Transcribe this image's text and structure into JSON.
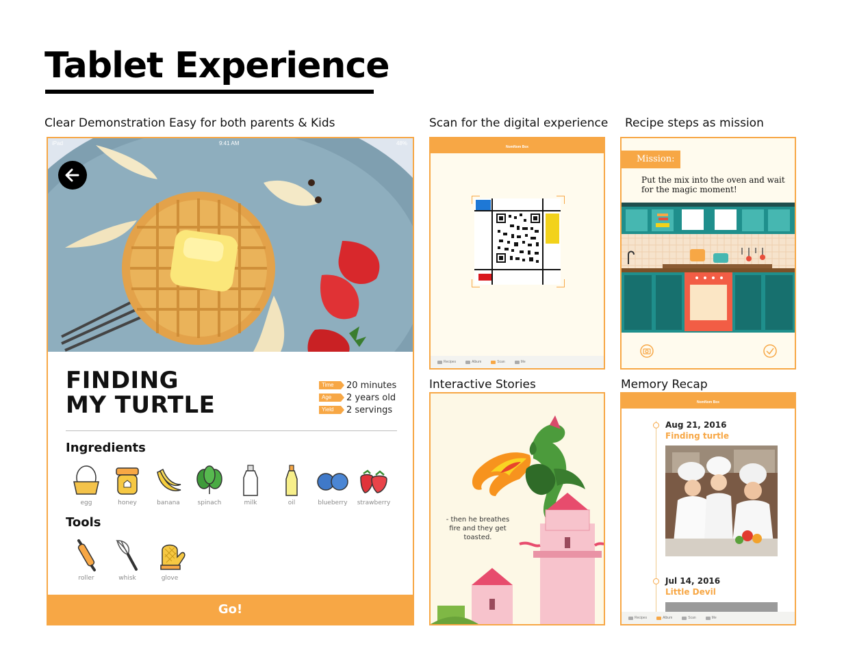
{
  "page": {
    "title": "Tablet Experience"
  },
  "captions": {
    "main": "Clear Demonstration Easy for both parents & Kids",
    "scan": "Scan for the digital experience",
    "mission": "Recipe steps as mission",
    "stories": "Interactive Stories",
    "memory": "Memory Recap"
  },
  "recipe_screen": {
    "status_carrier": "iPad",
    "status_time": "9:41 AM",
    "status_battery": "48%",
    "title_line1": "FINDING",
    "title_line2": "MY TURTLE",
    "meta": [
      {
        "tag": "Time",
        "value": "20 minutes"
      },
      {
        "tag": "Age",
        "value": "2 years old"
      },
      {
        "tag": "Yield",
        "value": "2 servings"
      }
    ],
    "ingredients_heading": "Ingredients",
    "ingredients": [
      "egg",
      "honey",
      "banana",
      "spinach",
      "milk",
      "oil",
      "blueberry",
      "strawberry"
    ],
    "tools_heading": "Tools",
    "tools": [
      "roller",
      "whisk",
      "glove"
    ],
    "go_label": "Go!"
  },
  "scan_screen": {
    "header_title": "NomNom Box",
    "tabs": [
      "Recipes",
      "Album",
      "Scan",
      "Me"
    ]
  },
  "mission_screen": {
    "tag": "Mission:",
    "text": "Put the mix into the oven and wait for the magic moment!"
  },
  "stories_screen": {
    "text": "- then he breathes fire and they get toasted."
  },
  "memory_screen": {
    "header_title": "NomNom Box",
    "entries": [
      {
        "date": "Aug 21, 2016",
        "title": "Finding turtle"
      },
      {
        "date": "Jul 14, 2016",
        "title": "Little Devil"
      }
    ],
    "tabs": [
      "Recipes",
      "Album",
      "Scan",
      "Me"
    ]
  },
  "colors": {
    "accent": "#f7a745",
    "cream": "#fffbee",
    "teal": "#1f8f8c"
  }
}
